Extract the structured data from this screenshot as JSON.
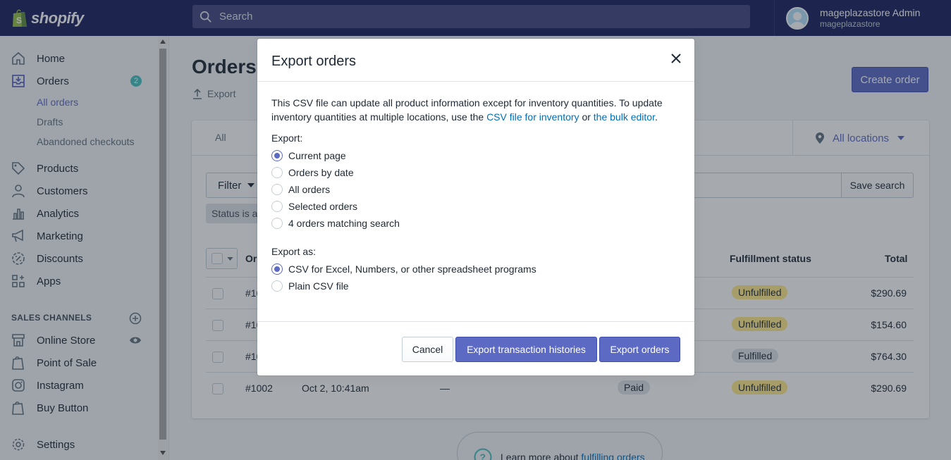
{
  "topbar": {
    "brand": "shopify",
    "search_placeholder": "Search",
    "user_name": "mageplazastore Admin",
    "user_store": "mageplazastore"
  },
  "sidebar": {
    "items": [
      {
        "label": "Home",
        "icon": "home-icon"
      },
      {
        "label": "Orders",
        "icon": "orders-icon",
        "badge": "2"
      },
      {
        "label": "Products",
        "icon": "tag-icon"
      },
      {
        "label": "Customers",
        "icon": "person-icon"
      },
      {
        "label": "Analytics",
        "icon": "bar-chart-icon"
      },
      {
        "label": "Marketing",
        "icon": "megaphone-icon"
      },
      {
        "label": "Discounts",
        "icon": "discount-icon"
      },
      {
        "label": "Apps",
        "icon": "apps-icon"
      }
    ],
    "orders_sub": [
      "All orders",
      "Drafts",
      "Abandoned checkouts"
    ],
    "sales_channels_title": "SALES CHANNELS",
    "channels": [
      {
        "label": "Online Store",
        "icon": "store-icon"
      },
      {
        "label": "Point of Sale",
        "icon": "shopify-bag-icon"
      },
      {
        "label": "Instagram",
        "icon": "instagram-icon"
      },
      {
        "label": "Buy Button",
        "icon": "shopify-bag-icon"
      }
    ],
    "settings": "Settings"
  },
  "main": {
    "title": "Orders",
    "export": "Export",
    "create_order": "Create order",
    "tab_all": "All",
    "all_locations": "All locations",
    "filter": "Filter",
    "save_search": "Save search",
    "status_chip": "Status is ar",
    "columns": {
      "order": "Or",
      "fulfillment": "Fulfillment status",
      "total": "Total"
    },
    "rows": [
      {
        "order": "#10",
        "fulfillment": "Unfulfilled",
        "total": "$290.69"
      },
      {
        "order": "#10",
        "fulfillment": "Unfulfilled",
        "total": "$154.60"
      },
      {
        "order": "#10",
        "fulfillment": "Fulfilled",
        "total": "$764.30"
      },
      {
        "order": "#1002",
        "date": "Oct 2, 10:41am",
        "customer": "—",
        "payment": "Paid",
        "fulfillment": "Unfulfilled",
        "total": "$290.69"
      }
    ],
    "help_text": "Learn more about ",
    "help_link": "fulfilling orders"
  },
  "modal": {
    "title": "Export orders",
    "desc_1": "This CSV file can update all product information except for inventory quantities. To update inventory quantities at multiple locations, use the ",
    "desc_link_1": "CSV file for inventory",
    "desc_mid": " or ",
    "desc_link_2": "the bulk editor",
    "desc_end": ".",
    "export_label": "Export:",
    "export_options": [
      "Current page",
      "Orders by date",
      "All orders",
      "Selected orders",
      "4 orders matching search"
    ],
    "export_selected": "Current page",
    "export_as_label": "Export as:",
    "export_as_options": [
      "CSV for Excel, Numbers, or other spreadsheet programs",
      "Plain CSV file"
    ],
    "export_as_selected": "CSV for Excel, Numbers, or other spreadsheet programs",
    "cancel": "Cancel",
    "export_histories": "Export transaction histories",
    "export_orders": "Export orders"
  },
  "colors": {
    "topbar": "#1c2260",
    "primary": "#5c6ac4",
    "link": "#006fbb",
    "unfulfilled": "#ffea8a",
    "badge": "#47c1bf"
  }
}
